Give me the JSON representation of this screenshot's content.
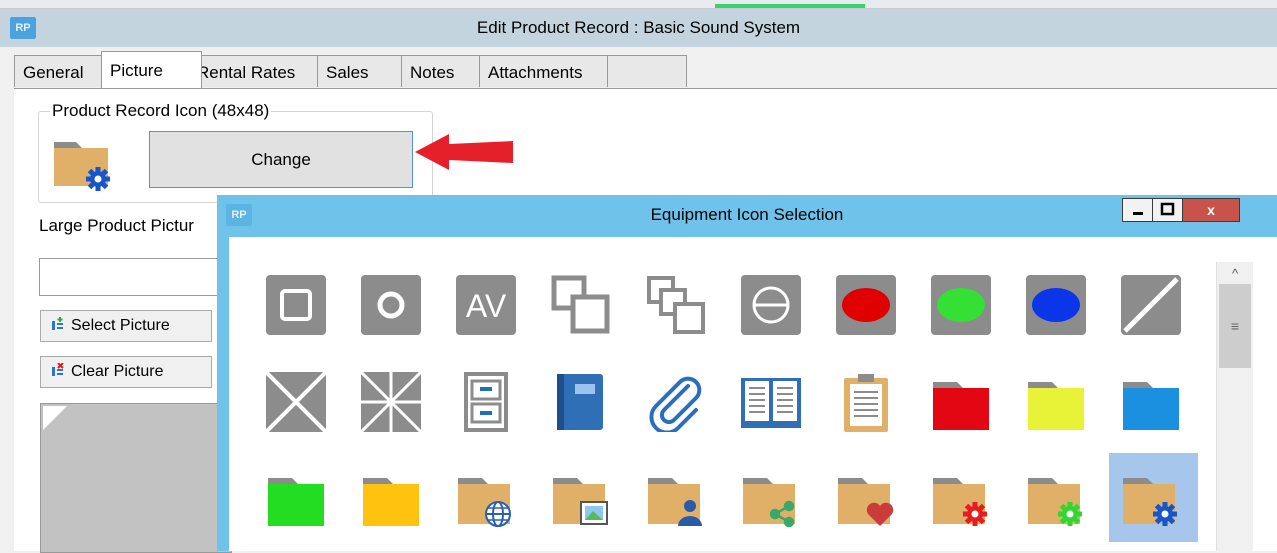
{
  "main_window": {
    "logo": "RP",
    "title": "Edit Product Record : Basic Sound System",
    "tabs": [
      {
        "label": "General"
      },
      {
        "label": "Picture"
      },
      {
        "label": "Rental Rates"
      },
      {
        "label": "Sales"
      },
      {
        "label": "Notes"
      },
      {
        "label": "Attachments"
      },
      {
        "label": ""
      }
    ],
    "active_tab": "Picture",
    "icon_group": {
      "legend": "Product Record Icon (48x48)",
      "change_label": "Change",
      "current_icon": "folder-gear-blue-icon"
    },
    "large_picture": {
      "label": "Large Product Pictur",
      "path_value": ""
    },
    "select_picture_label": "Select Picture",
    "clear_picture_label": "Clear Picture"
  },
  "dialog": {
    "logo": "RP",
    "title": "Equipment Icon Selection",
    "close_label": "x",
    "icons": [
      [
        "square-icon",
        "record-icon",
        "av-icon",
        "copy-icon",
        "multi-copy-icon",
        "minus-circle-icon",
        "red-ellipse-icon",
        "green-ellipse-icon",
        "blue-ellipse-icon",
        "diagonal-icon"
      ],
      [
        "x-box-icon",
        "asterisk-box-icon",
        "filing-cabinet-icon",
        "book-icon",
        "paperclip-icon",
        "open-book-icon",
        "clipboard-icon",
        "folder-red-icon",
        "folder-yellow-icon",
        "folder-blue-icon"
      ],
      [
        "folder-green-icon",
        "folder-orange-icon",
        "folder-globe-icon",
        "folder-picture-icon",
        "folder-user-icon",
        "folder-share-icon",
        "folder-heart-icon",
        "folder-gear-red-icon",
        "folder-gear-green-icon",
        "folder-gear-blue-icon"
      ]
    ],
    "selected_icon": "folder-gear-blue-icon"
  },
  "colors": {
    "title_bar": "#c3d4de",
    "dialog_frame": "#6fc3ea",
    "arrow": "#e5202a",
    "icon_gray": "#8c8c8c",
    "folder_tan": "#e0b068",
    "selection": "#a6c6ec"
  }
}
